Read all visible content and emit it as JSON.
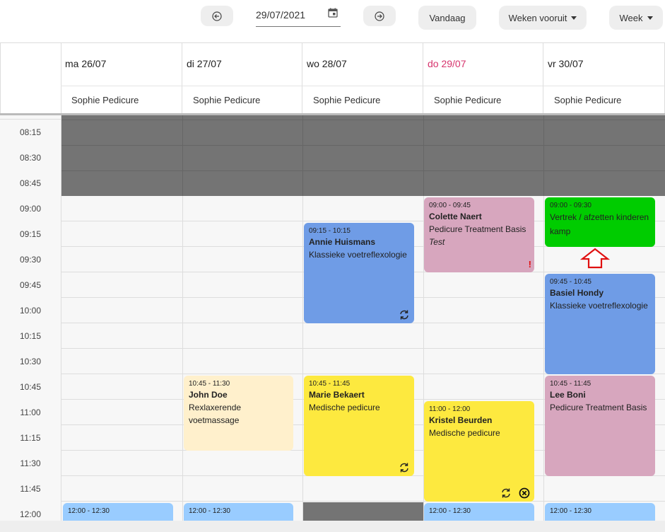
{
  "toolbar": {
    "prev_icon": "arrow-left-circle-icon",
    "next_icon": "arrow-right-circle-icon",
    "date_value": "29/07/2021",
    "calendar_icon": "calendar-icon",
    "today_label": "Vandaag",
    "weeks_ahead_label": "Weken vooruit",
    "view_label": "Week"
  },
  "days": [
    {
      "label": "ma 26/07",
      "resource": "Sophie Pedicure",
      "today": false
    },
    {
      "label": "di 27/07",
      "resource": "Sophie Pedicure",
      "today": false
    },
    {
      "label": "wo 28/07",
      "resource": "Sophie Pedicure",
      "today": true
    },
    {
      "label": "do 29/07",
      "resource": "Sophie Pedicure",
      "today": true
    },
    {
      "label": "vr 30/07",
      "resource": "Sophie Pedicure",
      "today": false
    }
  ],
  "times": [
    "08:15",
    "08:30",
    "08:45",
    "09:00",
    "09:15",
    "09:30",
    "09:45",
    "10:00",
    "10:15",
    "10:30",
    "10:45",
    "11:00",
    "11:15",
    "11:30",
    "11:45",
    "12:00"
  ],
  "appointments": {
    "a1": {
      "time": "09:15 - 10:15",
      "name": "Annie Huismans",
      "service": "Klassieke voetreflexologie",
      "color": "#6f9ce6",
      "icon": "repeat-icon"
    },
    "a2": {
      "time": "09:00 - 09:45",
      "name": "Colette Naert",
      "service": "Pedicure Treatment Basis",
      "note": "Test",
      "color": "#d7a6be",
      "icon": "warning-exclamation-icon"
    },
    "a3": {
      "time": "09:00 - 09:30",
      "title": "Vertrek / afzetten kinderen kamp",
      "color": "#00cc00"
    },
    "a4": {
      "time": "09:45 - 10:45",
      "name": "Basiel Hondy",
      "service": "Klassieke voetreflexologie",
      "color": "#6f9ce6"
    },
    "a5": {
      "time": "10:45 - 11:30",
      "name": "John Doe",
      "service": "Rexlaxerende voetmassage",
      "color": "#fff0cc"
    },
    "a6": {
      "time": "10:45 - 11:45",
      "name": "Marie Bekaert",
      "service": "Medische pedicure",
      "color": "#fde93f",
      "icon": "repeat-icon"
    },
    "a7": {
      "time": "11:00 - 12:00",
      "name": "Kristel Beurden",
      "service": "Medische pedicure",
      "color": "#fde93f",
      "icon": "repeat-icon",
      "icon2": "cancel-circle-icon"
    },
    "a8": {
      "time": "10:45 - 11:45",
      "name": "Lee Boni",
      "service": "Pedicure Treatment Basis",
      "color": "#d7a6be"
    },
    "b1": {
      "time": "12:00 - 12:30",
      "color": "#99ccff"
    },
    "b2": {
      "time": "12:00 - 12:30",
      "color": "#99ccff"
    },
    "b3": {
      "time": "12:00 - 12:30",
      "color": "#99ccff"
    },
    "b4": {
      "time": "12:00 - 12:30",
      "color": "#99ccff"
    }
  },
  "colors": {
    "closed": "#747474",
    "today": "#d6336c",
    "arrow": "#e01010"
  }
}
